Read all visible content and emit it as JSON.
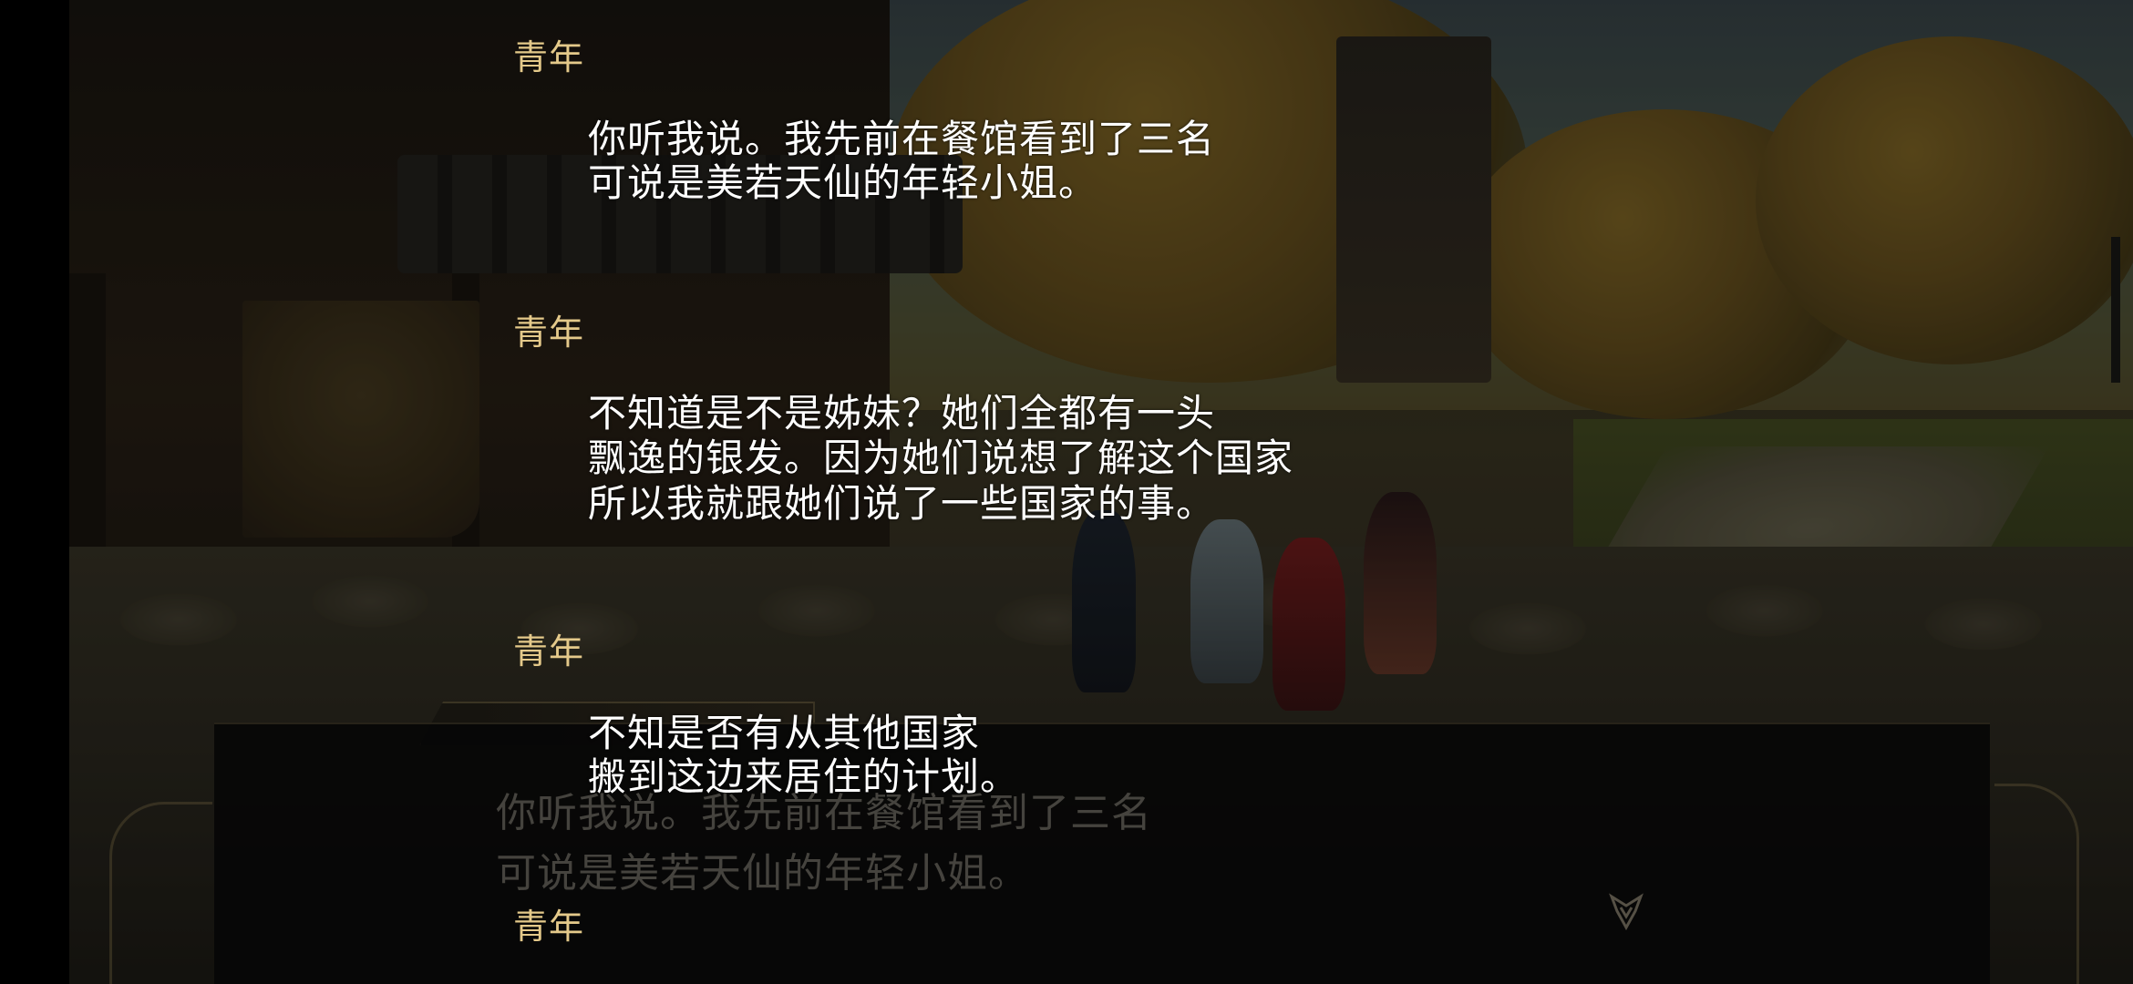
{
  "message_box": {
    "lines": [
      "你听我说。我先前在餐馆看到了三名",
      "可说是美若天仙的年轻小姐。"
    ]
  },
  "backlog": {
    "entries": [
      {
        "speaker": "青年",
        "lines": [
          "你听我说。我先前在餐馆看到了三名",
          "可说是美若天仙的年轻小姐。"
        ]
      },
      {
        "speaker": "青年",
        "lines": [
          "不知道是不是姊妹？她们全都有一头",
          "飘逸的银发。因为她们说想了解这个国家",
          "所以我就跟她们说了一些国家的事。"
        ]
      },
      {
        "speaker": "青年",
        "lines": [
          "不知是否有从其他国家",
          "搬到这边来居住的计划。"
        ]
      },
      {
        "speaker": "青年",
        "lines": []
      }
    ]
  },
  "colors": {
    "speaker": "#e4c98a",
    "dialog_text": "#ffffff"
  },
  "icons": {
    "advance": "next-arrow-icon"
  }
}
